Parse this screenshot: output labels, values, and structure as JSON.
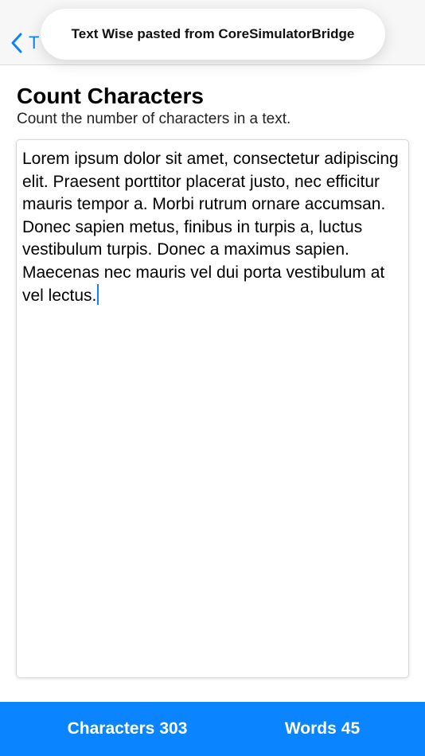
{
  "nav": {
    "back_label": "T",
    "back_icon": "chevron-left-icon"
  },
  "toast": {
    "message": "Text Wise pasted from CoreSimulatorBridge"
  },
  "page": {
    "title": "Count Characters",
    "subtitle": "Count the number of characters in a text."
  },
  "editor": {
    "text": "Lorem ipsum dolor sit amet, consectetur adipiscing elit. Praesent porttitor placerat justo, nec efficitur mauris tempor a. Morbi rutrum ornare accumsan. Donec sapien metus, finibus in turpis a, luctus vestibulum turpis. Donec a maximus sapien. Maecenas nec mauris vel dui porta vestibulum at vel lectus."
  },
  "stats": {
    "characters_label": "Characters",
    "characters_value": "303",
    "words_label": "Words",
    "words_value": "45"
  },
  "colors": {
    "accent": "#0a84ff",
    "nav_background": "#f7f7f7",
    "bottom_bar_text": "#ffffff"
  }
}
